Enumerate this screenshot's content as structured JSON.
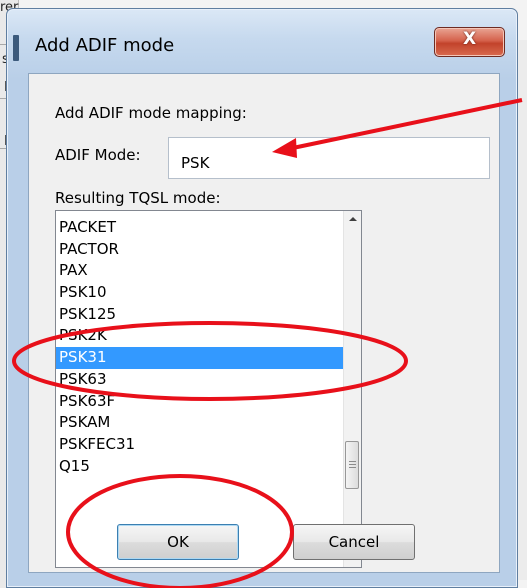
{
  "background": {
    "fragments": [
      "rer",
      "s",
      "D",
      "D"
    ]
  },
  "dialog": {
    "title": "Add ADIF mode",
    "close_label": "X",
    "heading": "Add ADIF mode mapping:",
    "adif_mode_label": "ADIF Mode:",
    "adif_mode_value": "PSK",
    "resulting_label": "Resulting TQSL mode:",
    "modes": [
      "PACKET",
      "PACTOR",
      "PAX",
      "PSK10",
      "PSK125",
      "PSK2K",
      "PSK31",
      "PSK63",
      "PSK63F",
      "PSKAM",
      "PSKFEC31",
      "Q15"
    ],
    "selected_mode": "PSK31",
    "ok_label": "OK",
    "cancel_label": "Cancel"
  },
  "colors": {
    "selection": "#3399ff",
    "annotation": "#e8101a"
  }
}
